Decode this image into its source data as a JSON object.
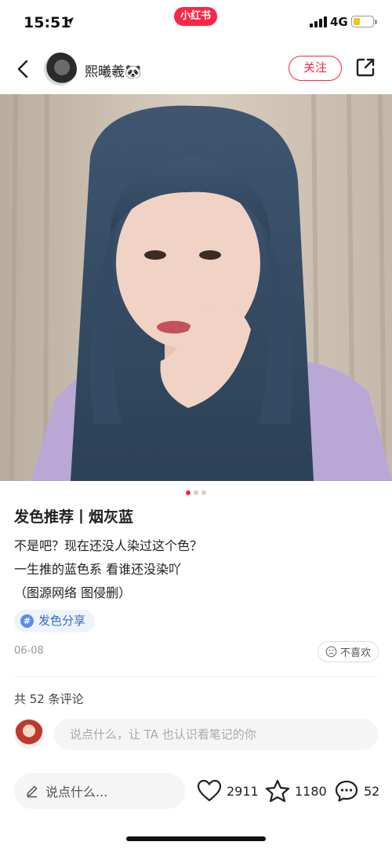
{
  "status_bar": {
    "time": "15:51",
    "app_badge": "小红书",
    "network": "4G",
    "battery_level": 0.35,
    "colors": {
      "badge": "#ff2442",
      "battery": "#f5c518"
    }
  },
  "header": {
    "username": "熙曦羲🐼",
    "follow_label": "关注",
    "icons": {
      "back": "chevron-left-icon",
      "share": "share-icon"
    }
  },
  "gallery": {
    "image_description_icon": "photo",
    "page_count": 3,
    "current_page": 1
  },
  "note": {
    "title": "发色推荐丨烟灰蓝",
    "body_lines": [
      "不是吧？现在还没人染过这个色？",
      "一生推的蓝色系 看谁还没染吖",
      "（图源网络 图侵删）"
    ],
    "tag": "发色分享",
    "date": "06-08",
    "dislike_label": "不喜欢"
  },
  "comments": {
    "count_text": "共 52 条评论",
    "input_placeholder": "说点什么，让 TA 也认识看笔记的你"
  },
  "bottom_bar": {
    "input_placeholder": "说点什么...",
    "likes": "2911",
    "collects": "1180",
    "comments": "52"
  },
  "colors": {
    "accent": "#ff2442",
    "tag_text": "#3b6fb6",
    "tag_bg": "#eef3fb"
  }
}
